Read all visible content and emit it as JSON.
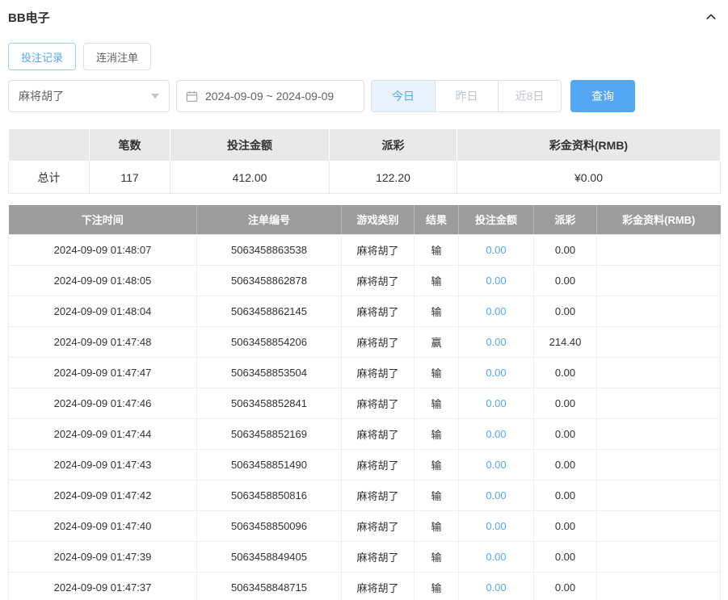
{
  "colors": {
    "accent": "#53a8f3",
    "search_button_bg": "#54a8f3",
    "table_header_bg": "#9c9c9c",
    "summary_header_bg": "#e9e9e9"
  },
  "header": {
    "title": "BB电子"
  },
  "tabs": [
    {
      "label": "投注记录",
      "active": true
    },
    {
      "label": "连消注单",
      "active": false
    }
  ],
  "filters": {
    "game_select": {
      "value": "麻将胡了"
    },
    "date_range": {
      "value": "2024-09-09 ~ 2024-09-09"
    },
    "quick_buttons": [
      {
        "label": "今日",
        "active": true
      },
      {
        "label": "昨日",
        "active": false
      },
      {
        "label": "近8日",
        "active": false
      }
    ],
    "search_label": "查询"
  },
  "summary": {
    "headers": [
      "",
      "笔数",
      "投注金额",
      "派彩",
      "彩金资料(RMB)"
    ],
    "row_label": "总计",
    "count": "117",
    "bet_amount": "412.00",
    "payout": "122.20",
    "bonus": "¥0.00"
  },
  "table": {
    "headers": [
      "下注时间",
      "注单编号",
      "游戏类别",
      "结果",
      "投注金额",
      "派彩",
      "彩金资料(RMB)"
    ],
    "rows": [
      {
        "time": "2024-09-09 01:48:07",
        "order": "5063458863538",
        "game": "麻将胡了",
        "result": "输",
        "bet": "0.00",
        "payout": "0.00",
        "bonus": ""
      },
      {
        "time": "2024-09-09 01:48:05",
        "order": "5063458862878",
        "game": "麻将胡了",
        "result": "输",
        "bet": "0.00",
        "payout": "0.00",
        "bonus": ""
      },
      {
        "time": "2024-09-09 01:48:04",
        "order": "5063458862145",
        "game": "麻将胡了",
        "result": "输",
        "bet": "0.00",
        "payout": "0.00",
        "bonus": ""
      },
      {
        "time": "2024-09-09 01:47:48",
        "order": "5063458854206",
        "game": "麻将胡了",
        "result": "赢",
        "bet": "0.00",
        "payout": "214.40",
        "bonus": ""
      },
      {
        "time": "2024-09-09 01:47:47",
        "order": "5063458853504",
        "game": "麻将胡了",
        "result": "输",
        "bet": "0.00",
        "payout": "0.00",
        "bonus": ""
      },
      {
        "time": "2024-09-09 01:47:46",
        "order": "5063458852841",
        "game": "麻将胡了",
        "result": "输",
        "bet": "0.00",
        "payout": "0.00",
        "bonus": ""
      },
      {
        "time": "2024-09-09 01:47:44",
        "order": "5063458852169",
        "game": "麻将胡了",
        "result": "输",
        "bet": "0.00",
        "payout": "0.00",
        "bonus": ""
      },
      {
        "time": "2024-09-09 01:47:43",
        "order": "5063458851490",
        "game": "麻将胡了",
        "result": "输",
        "bet": "0.00",
        "payout": "0.00",
        "bonus": ""
      },
      {
        "time": "2024-09-09 01:47:42",
        "order": "5063458850816",
        "game": "麻将胡了",
        "result": "输",
        "bet": "0.00",
        "payout": "0.00",
        "bonus": ""
      },
      {
        "time": "2024-09-09 01:47:40",
        "order": "5063458850096",
        "game": "麻将胡了",
        "result": "输",
        "bet": "0.00",
        "payout": "0.00",
        "bonus": ""
      },
      {
        "time": "2024-09-09 01:47:39",
        "order": "5063458849405",
        "game": "麻将胡了",
        "result": "输",
        "bet": "0.00",
        "payout": "0.00",
        "bonus": ""
      },
      {
        "time": "2024-09-09 01:47:37",
        "order": "5063458848715",
        "game": "麻将胡了",
        "result": "输",
        "bet": "0.00",
        "payout": "0.00",
        "bonus": ""
      }
    ]
  }
}
